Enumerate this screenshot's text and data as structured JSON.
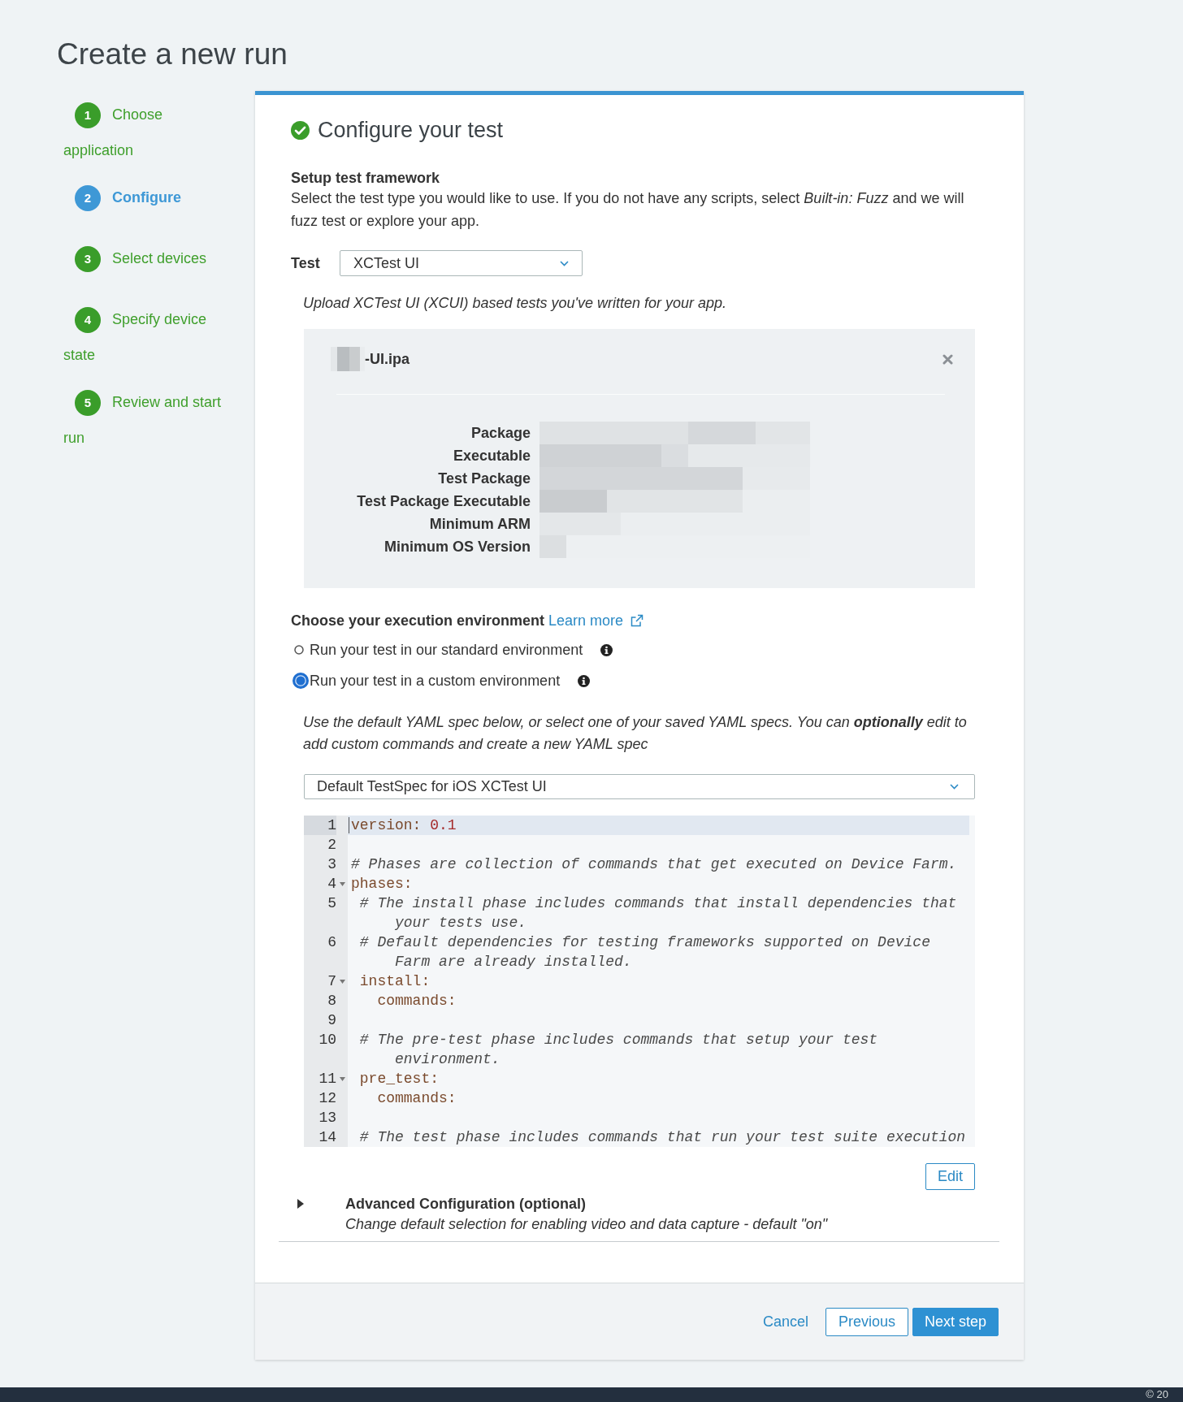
{
  "page_title": "Create a new run",
  "steps": [
    {
      "number": "1",
      "label": "Choose application",
      "selected": false
    },
    {
      "number": "2",
      "label": "Configure",
      "selected": true
    },
    {
      "number": "3",
      "label": "Select devices",
      "selected": false
    },
    {
      "number": "4",
      "label": "Specify device state",
      "selected": false
    },
    {
      "number": "5",
      "label": "Review and start run",
      "selected": false
    }
  ],
  "panel": {
    "title": "Configure your test",
    "framework": {
      "heading": "Setup test framework",
      "description": "Select the test type you would like to use. If you do not have any scripts, select *Built-in: Fuzz* and we will fuzz test or explore your app.",
      "test_label": "Test",
      "test_select": {
        "value": "XCTest UI"
      },
      "hint": "Upload XCTest UI (XCUI) based tests you've written for your app."
    },
    "upload": {
      "file_name": "-UI.ipa",
      "name_redacted": true,
      "details": [
        {
          "label": "Package",
          "redacted": true
        },
        {
          "label": "Executable",
          "redacted": true
        },
        {
          "label": "Test Package",
          "redacted": true
        },
        {
          "label": "Test Package Executable",
          "redacted": true
        },
        {
          "label": "Minimum ARM",
          "redacted": true
        },
        {
          "label": "Minimum OS Version",
          "redacted": true
        }
      ]
    },
    "environment": {
      "heading": "Choose your execution environment",
      "link": "Learn more",
      "options": [
        {
          "label": "Run your test in our standard environment",
          "selected": false
        },
        {
          "label": "Run your test in a custom environment",
          "selected": true
        }
      ],
      "note": "Use the default YAML spec below, or select one of your saved YAML specs. You can **optionally** edit to add custom commands and create a new YAML spec",
      "spec_select": {
        "value": "Default TestSpec for iOS XCTest UI"
      },
      "editor": {
        "lines": [
          {
            "number": "1",
            "active": true,
            "foldable": false,
            "segments": [
              {
                "kind": "key",
                "text": "version:"
              },
              {
                "kind": "number",
                "text": " 0.1"
              }
            ]
          },
          {
            "number": "2",
            "active": false,
            "foldable": false
          },
          {
            "number": "3",
            "active": false,
            "foldable": false,
            "segments": [
              {
                "kind": "comment",
                "text": "# Phases are collection of commands that get executed on Device Farm."
              }
            ]
          },
          {
            "number": "4",
            "active": false,
            "foldable": true,
            "segments": [
              {
                "kind": "key",
                "text": "phases:"
              }
            ]
          },
          {
            "number": "5",
            "active": false,
            "foldable": false,
            "segments": [
              {
                "kind": "comment",
                "text": " # The install phase includes commands that install dependencies that your tests use."
              }
            ]
          },
          {
            "number": "6",
            "active": false,
            "foldable": false,
            "segments": [
              {
                "kind": "comment",
                "text": " # Default dependencies for testing frameworks supported on Device Farm are already installed."
              }
            ]
          },
          {
            "number": "7",
            "active": false,
            "foldable": true,
            "segments": [
              {
                "kind": "key",
                "text": " install:"
              }
            ]
          },
          {
            "number": "8",
            "active": false,
            "foldable": false,
            "segments": [
              {
                "kind": "key",
                "text": "   commands:"
              }
            ]
          },
          {
            "number": "9",
            "active": false,
            "foldable": false
          },
          {
            "number": "10",
            "active": false,
            "foldable": false,
            "segments": [
              {
                "kind": "comment",
                "text": " # The pre-test phase includes commands that setup your test environment."
              }
            ]
          },
          {
            "number": "11",
            "active": false,
            "foldable": true,
            "segments": [
              {
                "kind": "key",
                "text": " pre_test:"
              }
            ]
          },
          {
            "number": "12",
            "active": false,
            "foldable": false,
            "segments": [
              {
                "kind": "key",
                "text": "   commands:"
              }
            ]
          },
          {
            "number": "13",
            "active": false,
            "foldable": false
          },
          {
            "number": "14",
            "active": false,
            "foldable": false,
            "segments": [
              {
                "kind": "comment",
                "text": " # The test phase includes commands that run your test suite execution"
              }
            ]
          }
        ]
      },
      "edit_button": "Edit"
    },
    "advanced": {
      "title": "Advanced Configuration (optional)",
      "description": "Change default selection for enabling video and data capture - default \"on\"",
      "expanded": false
    }
  },
  "footer": {
    "buttons": [
      {
        "label": "Cancel",
        "kind": "link"
      },
      {
        "label": "Previous",
        "kind": "secondary"
      },
      {
        "label": "Next step",
        "kind": "primary"
      }
    ]
  },
  "bottom_bar": {
    "text": "© 20"
  }
}
